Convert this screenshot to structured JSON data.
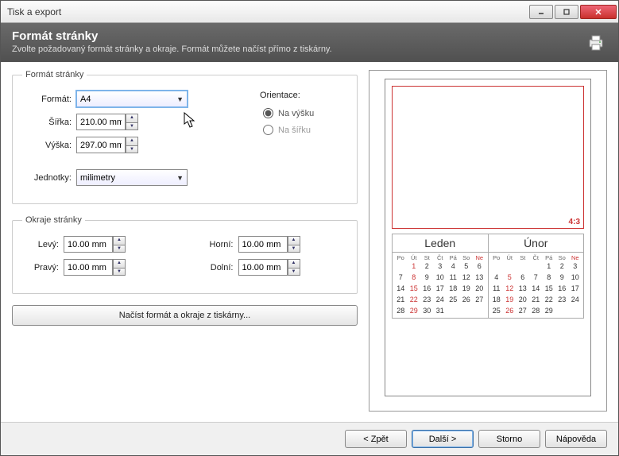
{
  "window": {
    "title": "Tisk a export"
  },
  "header": {
    "title": "Formát stránky",
    "subtitle": "Zvolte požadovaný formát stránky a okraje. Formát můžete načíst přímo z tiskárny."
  },
  "fs_format": {
    "legend": "Formát stránky",
    "format_label": "Formát:",
    "format_value": "A4",
    "width_label": "Šířka:",
    "width_value": "210.00 mm",
    "height_label": "Výška:",
    "height_value": "297.00 mm",
    "units_label": "Jednotky:",
    "units_value": "milimetry",
    "orient_label": "Orientace:",
    "orient_portrait": "Na výšku",
    "orient_landscape": "Na šířku"
  },
  "fs_margins": {
    "legend": "Okraje stránky",
    "left_label": "Levý:",
    "left_value": "10.00 mm",
    "right_label": "Pravý:",
    "right_value": "10.00 mm",
    "top_label": "Horní:",
    "top_value": "10.00 mm",
    "bottom_label": "Dolní:",
    "bottom_value": "10.00 mm"
  },
  "load_button": "Načíst formát a okraje z tiskárny...",
  "preview": {
    "ratio": "4:3",
    "month1": {
      "name": "Leden",
      "dow": [
        "Po",
        "Út",
        "St",
        "Čt",
        "Pá",
        "So",
        "Ne"
      ],
      "offset": 1,
      "ndays": 31,
      "suns": [
        1,
        8,
        15,
        22,
        29
      ]
    },
    "month2": {
      "name": "Únor",
      "dow": [
        "Po",
        "Út",
        "St",
        "Čt",
        "Pá",
        "So",
        "Ne"
      ],
      "offset": 4,
      "ndays": 29,
      "suns": [
        5,
        12,
        19,
        26
      ]
    }
  },
  "buttons": {
    "back": "< Zpět",
    "next": "Další >",
    "cancel": "Storno",
    "help": "Nápověda"
  }
}
